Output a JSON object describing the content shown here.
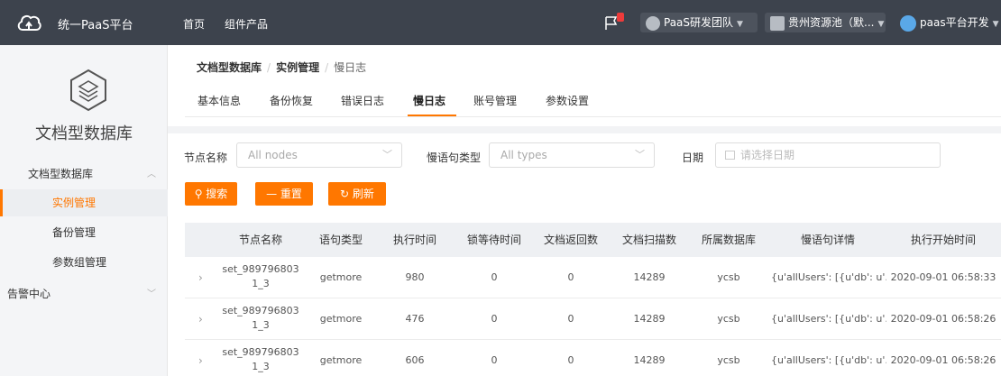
{
  "header": {
    "brand": "统一PaaS平台",
    "nav": [
      "首页",
      "组件产品"
    ],
    "team": "PaaS研发团队",
    "pool": "贵州资源池（默...",
    "user": "paas平台开发"
  },
  "sidebar": {
    "title": "文档型数据库",
    "group1": "文档型数据库",
    "items": [
      "实例管理",
      "备份管理",
      "参数组管理"
    ],
    "group2": "告警中心"
  },
  "breadcrumb": [
    "文档型数据库",
    "实例管理",
    "慢日志"
  ],
  "tabs": [
    "基本信息",
    "备份恢复",
    "错误日志",
    "慢日志",
    "账号管理",
    "参数设置"
  ],
  "filters": {
    "node_label": "节点名称",
    "node_placeholder": "All nodes",
    "type_label": "慢语句类型",
    "type_placeholder": "All types",
    "date_label": "日期",
    "date_placeholder": "请选择日期"
  },
  "buttons": {
    "search": "搜索",
    "reset": "重置",
    "refresh": "刷新"
  },
  "columns": [
    "节点名称",
    "语句类型",
    "执行时间",
    "锁等待时间",
    "文档返回数",
    "文档扫描数",
    "所属数据库",
    "慢语句详情",
    "执行开始时间"
  ],
  "rows": [
    {
      "node1": "set_989796803",
      "node2": "1_3",
      "type": "getmore",
      "time": "980",
      "lock": "0",
      "ret": "0",
      "scan": "14289",
      "db": "ycsb",
      "detail": "{u'allUsers': [{u'db': u'...",
      "start": "2020-09-01 06:58:33"
    },
    {
      "node1": "set_989796803",
      "node2": "1_3",
      "type": "getmore",
      "time": "476",
      "lock": "0",
      "ret": "0",
      "scan": "14289",
      "db": "ycsb",
      "detail": "{u'allUsers': [{u'db': u'...",
      "start": "2020-09-01 06:58:26"
    },
    {
      "node1": "set_989796803",
      "node2": "1_3",
      "type": "getmore",
      "time": "606",
      "lock": "0",
      "ret": "0",
      "scan": "14289",
      "db": "ycsb",
      "detail": "{u'allUsers': [{u'db': u'...",
      "start": "2020-09-01 06:58:26"
    }
  ],
  "colors": {
    "accent": "#ff7700",
    "topbar": "#3d434d"
  }
}
